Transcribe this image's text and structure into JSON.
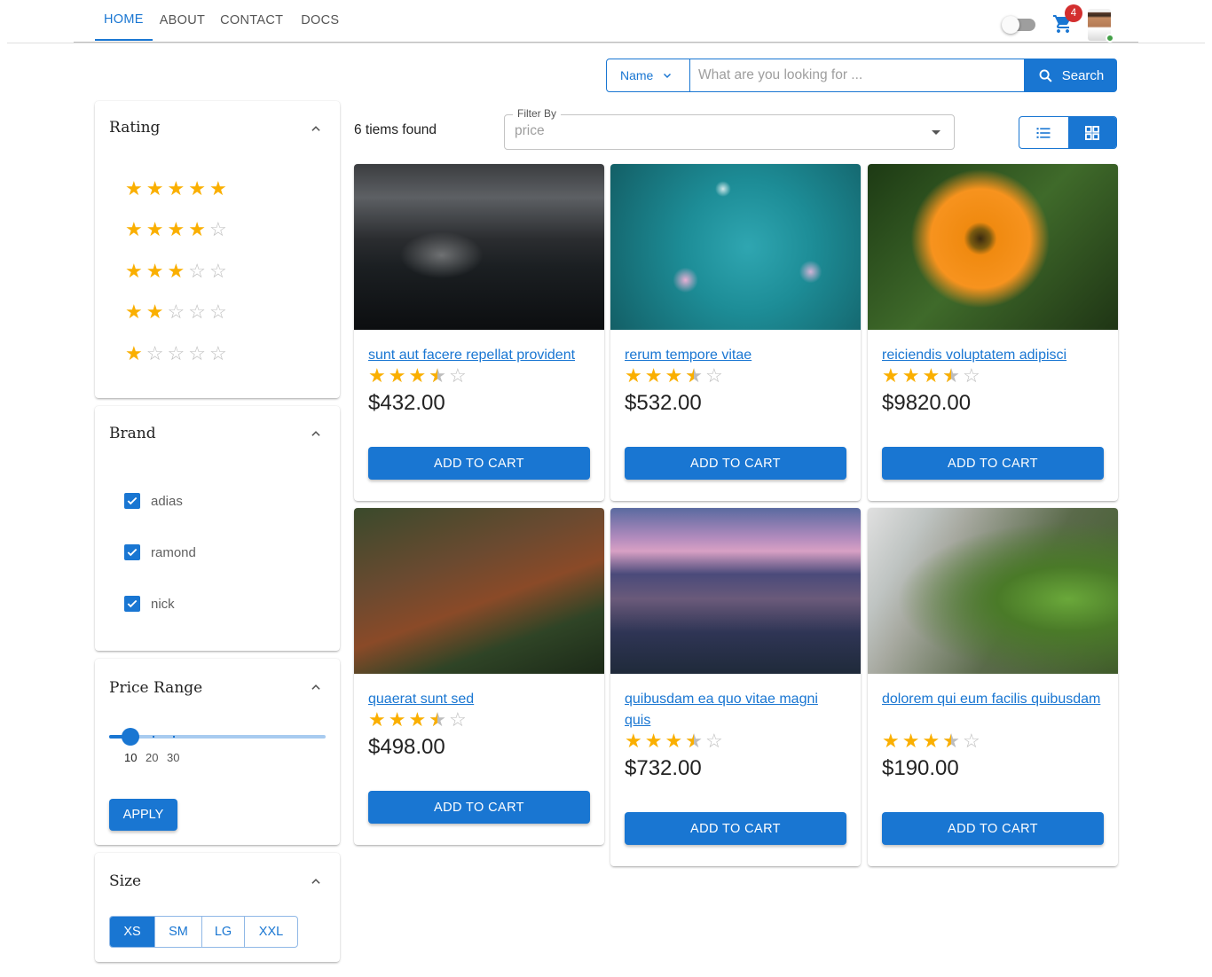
{
  "nav": {
    "items": [
      "HOME",
      "ABOUT",
      "CONTACT",
      "DOCS"
    ],
    "active": "HOME"
  },
  "header": {
    "cart_count": "4",
    "theme_toggle": "off"
  },
  "search": {
    "field_label": "Name",
    "placeholder": "What are you looking for ...",
    "button_label": "Search"
  },
  "filters": {
    "rating": {
      "title": "Rating",
      "options": [
        5,
        4,
        3,
        2,
        1
      ]
    },
    "brand": {
      "title": "Brand",
      "items": [
        {
          "label": "adias",
          "checked": true
        },
        {
          "label": "ramond",
          "checked": true
        },
        {
          "label": "nick",
          "checked": true
        }
      ]
    },
    "price_range": {
      "title": "Price Range",
      "value": 10,
      "marks": [
        "10",
        "20",
        "30"
      ],
      "apply_label": "APPLY"
    },
    "size": {
      "title": "Size",
      "options": [
        "XS",
        "SM",
        "LG",
        "XXL"
      ],
      "selected": "XS"
    }
  },
  "results": {
    "count_text": "6 tiems found",
    "filter_label": "Filter By",
    "filter_value": "price",
    "view_mode": "grid"
  },
  "products": [
    {
      "title": "sunt aut facere repellat provident",
      "rating": 3.5,
      "price": "$432.00",
      "button": "ADD TO CART",
      "image": "night-city-skyline"
    },
    {
      "title": "rerum tempore vitae",
      "rating": 3.5,
      "price": "$532.00",
      "button": "ADD TO CART",
      "image": "confetti-teal"
    },
    {
      "title": "reiciendis voluptatem adipisci",
      "rating": 3.5,
      "price": "$9820.00",
      "button": "ADD TO CART",
      "image": "orange-flower"
    },
    {
      "title": "quaerat sunt sed",
      "rating": 3.5,
      "price": "$498.00",
      "button": "ADD TO CART",
      "image": "forest-logs"
    },
    {
      "title": "quibusdam ea quo vitae magni quis",
      "rating": 3.5,
      "price": "$732.00",
      "button": "ADD TO CART",
      "image": "volcano-sunrise"
    },
    {
      "title": "dolorem qui eum facilis quibusdam",
      "rating": 3.5,
      "price": "$190.00",
      "button": "ADD TO CART",
      "image": "lavender-fence"
    }
  ],
  "colors": {
    "primary": "#1976d2",
    "star": "#faaf00",
    "badge": "#d32f2f",
    "online": "#43a047"
  }
}
